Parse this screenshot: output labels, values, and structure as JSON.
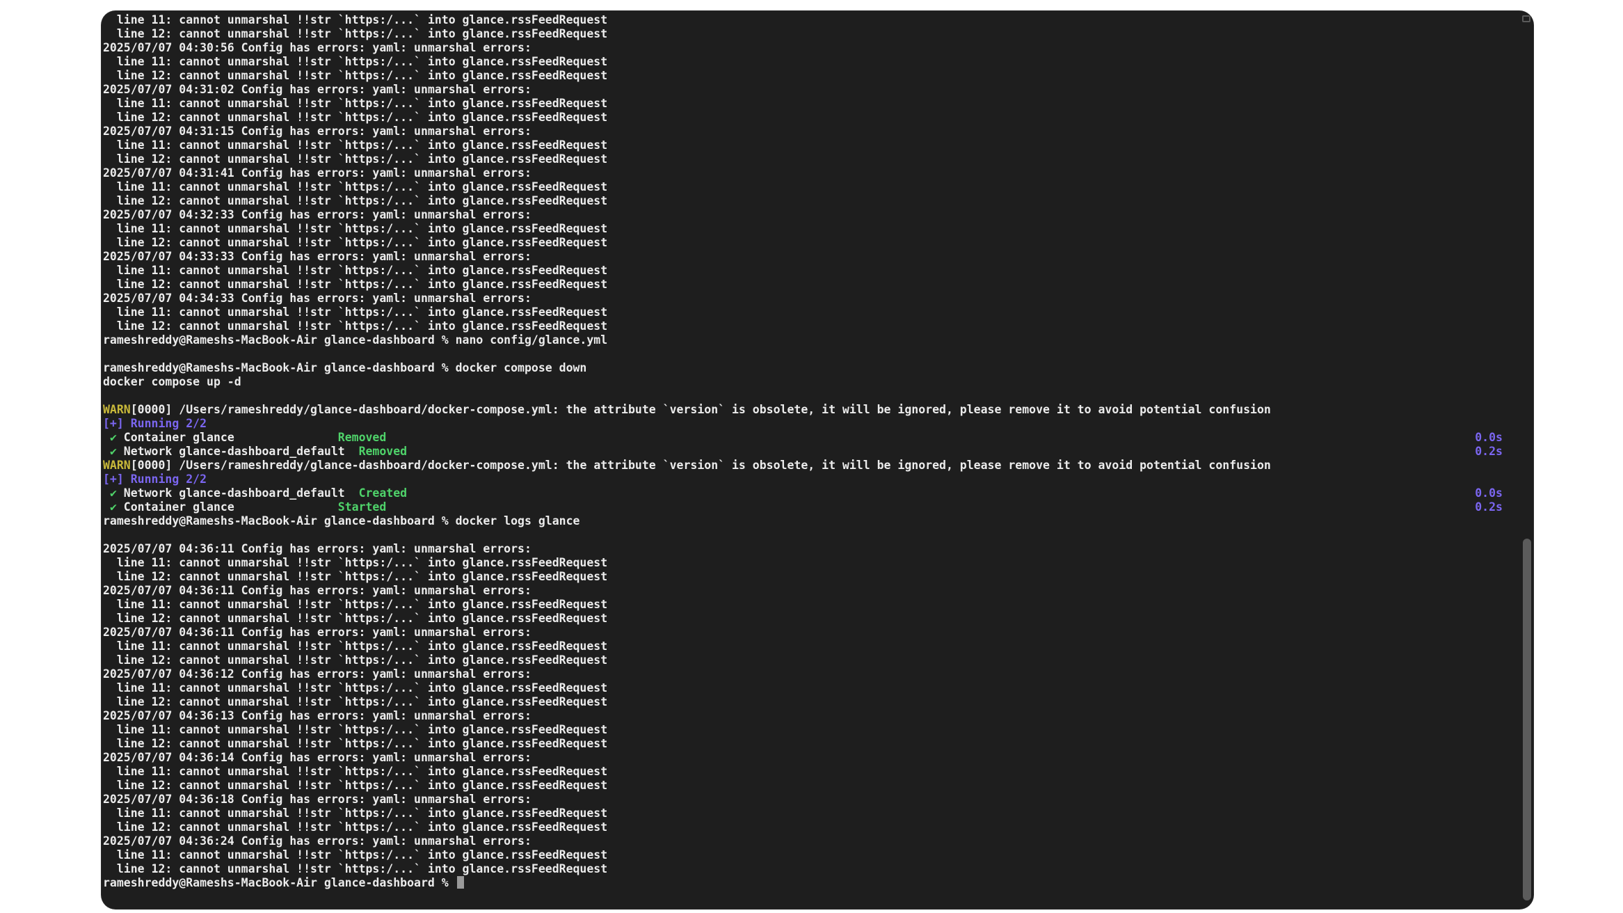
{
  "terminal": {
    "lines_top": [
      "  line 11: cannot unmarshal !!str `https:/...` into glance.rssFeedRequest",
      "  line 12: cannot unmarshal !!str `https:/...` into glance.rssFeedRequest",
      "2025/07/07 04:30:56 Config has errors: yaml: unmarshal errors:",
      "  line 11: cannot unmarshal !!str `https:/...` into glance.rssFeedRequest",
      "  line 12: cannot unmarshal !!str `https:/...` into glance.rssFeedRequest",
      "2025/07/07 04:31:02 Config has errors: yaml: unmarshal errors:",
      "  line 11: cannot unmarshal !!str `https:/...` into glance.rssFeedRequest",
      "  line 12: cannot unmarshal !!str `https:/...` into glance.rssFeedRequest",
      "2025/07/07 04:31:15 Config has errors: yaml: unmarshal errors:",
      "  line 11: cannot unmarshal !!str `https:/...` into glance.rssFeedRequest",
      "  line 12: cannot unmarshal !!str `https:/...` into glance.rssFeedRequest",
      "2025/07/07 04:31:41 Config has errors: yaml: unmarshal errors:",
      "  line 11: cannot unmarshal !!str `https:/...` into glance.rssFeedRequest",
      "  line 12: cannot unmarshal !!str `https:/...` into glance.rssFeedRequest",
      "2025/07/07 04:32:33 Config has errors: yaml: unmarshal errors:",
      "  line 11: cannot unmarshal !!str `https:/...` into glance.rssFeedRequest",
      "  line 12: cannot unmarshal !!str `https:/...` into glance.rssFeedRequest",
      "2025/07/07 04:33:33 Config has errors: yaml: unmarshal errors:",
      "  line 11: cannot unmarshal !!str `https:/...` into glance.rssFeedRequest",
      "  line 12: cannot unmarshal !!str `https:/...` into glance.rssFeedRequest",
      "2025/07/07 04:34:33 Config has errors: yaml: unmarshal errors:",
      "  line 11: cannot unmarshal !!str `https:/...` into glance.rssFeedRequest",
      "  line 12: cannot unmarshal !!str `https:/...` into glance.rssFeedRequest",
      "rameshreddy@Rameshs-MacBook-Air glance-dashboard % nano config/glance.yml",
      "",
      "rameshreddy@Rameshs-MacBook-Air glance-dashboard % docker compose down",
      "docker compose up -d",
      ""
    ],
    "warn_label": "WARN",
    "warn_message": "[0000] /Users/rameshreddy/glance-dashboard/docker-compose.yml: the attribute `version` is obsolete, it will be ignored, please remove it to avoid potential confusion",
    "running_label": "[+] Running 2/2",
    "check_mark": "✔",
    "down_block": [
      {
        "item": " Container glance               ",
        "status": "Removed",
        "time": "0.0s"
      },
      {
        "item": " Network glance-dashboard_default  ",
        "status": "Removed",
        "time": "0.2s"
      }
    ],
    "up_block": [
      {
        "item": " Network glance-dashboard_default  ",
        "status": "Created",
        "time": "0.0s"
      },
      {
        "item": " Container glance               ",
        "status": "Started",
        "time": "0.2s"
      }
    ],
    "logs_command": "rameshreddy@Rameshs-MacBook-Air glance-dashboard % docker logs glance",
    "lines_bottom": [
      "",
      "2025/07/07 04:36:11 Config has errors: yaml: unmarshal errors:",
      "  line 11: cannot unmarshal !!str `https:/...` into glance.rssFeedRequest",
      "  line 12: cannot unmarshal !!str `https:/...` into glance.rssFeedRequest",
      "2025/07/07 04:36:11 Config has errors: yaml: unmarshal errors:",
      "  line 11: cannot unmarshal !!str `https:/...` into glance.rssFeedRequest",
      "  line 12: cannot unmarshal !!str `https:/...` into glance.rssFeedRequest",
      "2025/07/07 04:36:11 Config has errors: yaml: unmarshal errors:",
      "  line 11: cannot unmarshal !!str `https:/...` into glance.rssFeedRequest",
      "  line 12: cannot unmarshal !!str `https:/...` into glance.rssFeedRequest",
      "2025/07/07 04:36:12 Config has errors: yaml: unmarshal errors:",
      "  line 11: cannot unmarshal !!str `https:/...` into glance.rssFeedRequest",
      "  line 12: cannot unmarshal !!str `https:/...` into glance.rssFeedRequest",
      "2025/07/07 04:36:13 Config has errors: yaml: unmarshal errors:",
      "  line 11: cannot unmarshal !!str `https:/...` into glance.rssFeedRequest",
      "  line 12: cannot unmarshal !!str `https:/...` into glance.rssFeedRequest",
      "2025/07/07 04:36:14 Config has errors: yaml: unmarshal errors:",
      "  line 11: cannot unmarshal !!str `https:/...` into glance.rssFeedRequest",
      "  line 12: cannot unmarshal !!str `https:/...` into glance.rssFeedRequest",
      "2025/07/07 04:36:18 Config has errors: yaml: unmarshal errors:",
      "  line 11: cannot unmarshal !!str `https:/...` into glance.rssFeedRequest",
      "  line 12: cannot unmarshal !!str `https:/...` into glance.rssFeedRequest",
      "2025/07/07 04:36:24 Config has errors: yaml: unmarshal errors:",
      "  line 11: cannot unmarshal !!str `https:/...` into glance.rssFeedRequest",
      "  line 12: cannot unmarshal !!str `https:/...` into glance.rssFeedRequest"
    ],
    "prompt": "rameshreddy@Rameshs-MacBook-Air glance-dashboard % "
  },
  "colors": {
    "background": "#1e1e1e",
    "text": "#ececec",
    "warn": "#c9b93a",
    "running": "#7b66f0",
    "success": "#4fd36a"
  }
}
